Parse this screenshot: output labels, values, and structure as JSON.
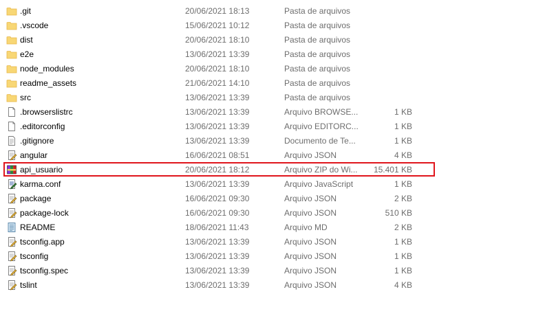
{
  "files": [
    {
      "name": ".git",
      "date": "20/06/2021 18:13",
      "type": "Pasta de arquivos",
      "size": "",
      "icon": "folder-icon"
    },
    {
      "name": ".vscode",
      "date": "15/06/2021 10:12",
      "type": "Pasta de arquivos",
      "size": "",
      "icon": "folder-icon"
    },
    {
      "name": "dist",
      "date": "20/06/2021 18:10",
      "type": "Pasta de arquivos",
      "size": "",
      "icon": "folder-icon"
    },
    {
      "name": "e2e",
      "date": "13/06/2021 13:39",
      "type": "Pasta de arquivos",
      "size": "",
      "icon": "folder-icon"
    },
    {
      "name": "node_modules",
      "date": "20/06/2021 18:10",
      "type": "Pasta de arquivos",
      "size": "",
      "icon": "folder-icon"
    },
    {
      "name": "readme_assets",
      "date": "21/06/2021 14:10",
      "type": "Pasta de arquivos",
      "size": "",
      "icon": "folder-icon"
    },
    {
      "name": "src",
      "date": "13/06/2021 13:39",
      "type": "Pasta de arquivos",
      "size": "",
      "icon": "folder-icon"
    },
    {
      "name": ".browserslistrc",
      "date": "13/06/2021 13:39",
      "type": "Arquivo BROWSE...",
      "size": "1 KB",
      "icon": "blank-file-icon"
    },
    {
      "name": ".editorconfig",
      "date": "13/06/2021 13:39",
      "type": "Arquivo EDITORC...",
      "size": "1 KB",
      "icon": "blank-file-icon"
    },
    {
      "name": ".gitignore",
      "date": "13/06/2021 13:39",
      "type": "Documento de Te...",
      "size": "1 KB",
      "icon": "text-file-icon"
    },
    {
      "name": "angular",
      "date": "16/06/2021 08:51",
      "type": "Arquivo JSON",
      "size": "4 KB",
      "icon": "json-file-icon"
    },
    {
      "name": "api_usuario",
      "date": "20/06/2021 18:12",
      "type": "Arquivo ZIP do Wi...",
      "size": "15.401 KB",
      "icon": "zip-archive-icon",
      "highlighted": true
    },
    {
      "name": "karma.conf",
      "date": "13/06/2021 13:39",
      "type": "Arquivo JavaScript",
      "size": "1 KB",
      "icon": "script-file-icon"
    },
    {
      "name": "package",
      "date": "16/06/2021 09:30",
      "type": "Arquivo JSON",
      "size": "2 KB",
      "icon": "json-file-icon"
    },
    {
      "name": "package-lock",
      "date": "16/06/2021 09:30",
      "type": "Arquivo JSON",
      "size": "510 KB",
      "icon": "json-file-icon"
    },
    {
      "name": "README",
      "date": "18/06/2021 11:43",
      "type": "Arquivo MD",
      "size": "2 KB",
      "icon": "md-file-icon"
    },
    {
      "name": "tsconfig.app",
      "date": "13/06/2021 13:39",
      "type": "Arquivo JSON",
      "size": "1 KB",
      "icon": "json-file-icon"
    },
    {
      "name": "tsconfig",
      "date": "13/06/2021 13:39",
      "type": "Arquivo JSON",
      "size": "1 KB",
      "icon": "json-file-icon"
    },
    {
      "name": "tsconfig.spec",
      "date": "13/06/2021 13:39",
      "type": "Arquivo JSON",
      "size": "1 KB",
      "icon": "json-file-icon"
    },
    {
      "name": "tslint",
      "date": "13/06/2021 13:39",
      "type": "Arquivo JSON",
      "size": "4 KB",
      "icon": "json-file-icon"
    }
  ],
  "colors": {
    "folder": "#f8d775",
    "folder_dark": "#e7b64a",
    "highlight_border": "#e0141b",
    "secondary_text": "#6d6d6d"
  }
}
